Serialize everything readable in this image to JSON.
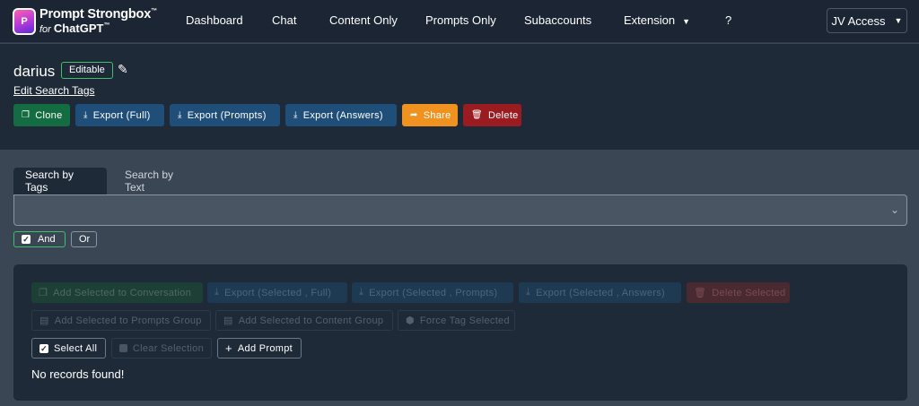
{
  "brand": {
    "badge": "P",
    "line1": "Prompt Strongbox",
    "line1_tm": "™",
    "for": "for",
    "line2": "ChatGPT",
    "line2_tm": "™"
  },
  "nav": {
    "dashboard": "Dashboard",
    "chat": "Chat",
    "content_only": "Content Only",
    "prompts_only": "Prompts Only",
    "subaccounts": "Subaccounts",
    "extension": "Extension",
    "help": "?",
    "account": "JV Access"
  },
  "header": {
    "title": "darius",
    "editable_badge": "Editable",
    "edit_search_tags": "Edit Search Tags"
  },
  "actions": {
    "clone": "Clone",
    "export_full": "Export (Full)",
    "export_prompts": "Export (Prompts)",
    "export_answers": "Export (Answers)",
    "share": "Share",
    "delete": "Delete"
  },
  "search": {
    "tab_tags": "Search by Tags",
    "tab_text": "Search by Text",
    "and_label": "And",
    "or_label": "Or"
  },
  "panel": {
    "add_to_conversation": "Add Selected to Conversation",
    "export_selected_full": "Export (Selected , Full)",
    "export_selected_prompts": "Export (Selected , Prompts)",
    "export_selected_answers": "Export (Selected , Answers)",
    "delete_selected": "Delete Selected",
    "add_to_prompts_group": "Add Selected to Prompts Group",
    "add_to_content_group": "Add Selected to Content Group",
    "force_tag_selected": "Force Tag Selected",
    "select_all": "Select All",
    "clear_selection": "Clear Selection",
    "add_prompt": "Add Prompt",
    "no_records": "No records found!"
  },
  "colors": {
    "navbar": "#1b2533",
    "clone": "#146c43",
    "export": "#1f4e79",
    "share": "#f0921f",
    "delete": "#9b1c20",
    "editable_border": "#3fbf6a"
  },
  "icons": {
    "pencil": "pencil-icon",
    "clone": "clone-icon",
    "download": "download-icon",
    "share": "share-icon",
    "trash": "trash-icon",
    "chevron": "chevron-down-icon",
    "tag": "tag-icon",
    "plus": "plus-icon"
  }
}
